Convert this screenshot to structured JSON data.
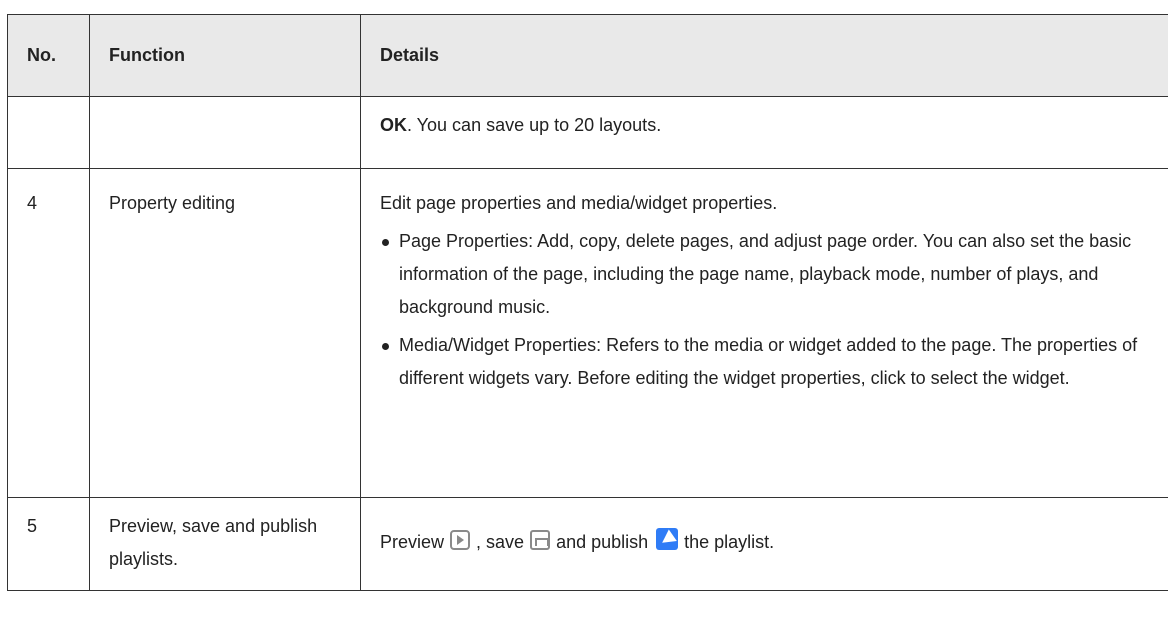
{
  "table": {
    "headers": {
      "no": "No.",
      "function": "Function",
      "details": "Details"
    },
    "row_ok": {
      "no": "",
      "function": "",
      "details_bold": "OK",
      "details_rest": ". You can save up to 20 layouts."
    },
    "row4": {
      "no": "4",
      "function": "Property editing",
      "intro": "Edit page properties and media/widget properties.",
      "bullets": [
        "Page Properties: Add, copy, delete pages, and adjust page order. You can also set the basic information of the page, including the page name, playback mode, number of plays, and background music.",
        "Media/Widget Properties: Refers to the media or widget added to the page. The properties of different widgets vary. Before editing the widget properties, click to select the widget."
      ]
    },
    "row5": {
      "no": "5",
      "function": "Preview, save and publish playlists.",
      "text_preview": "Preview",
      "text_save": ", save",
      "text_publish": "and publish",
      "text_end": "the playlist."
    }
  },
  "icons": {
    "preview": "preview-icon",
    "save": "save-icon",
    "publish": "publish-icon"
  },
  "colors": {
    "header_bg": "#e9e9e9",
    "border": "#333333",
    "publish_icon": "#2f7cf6"
  }
}
